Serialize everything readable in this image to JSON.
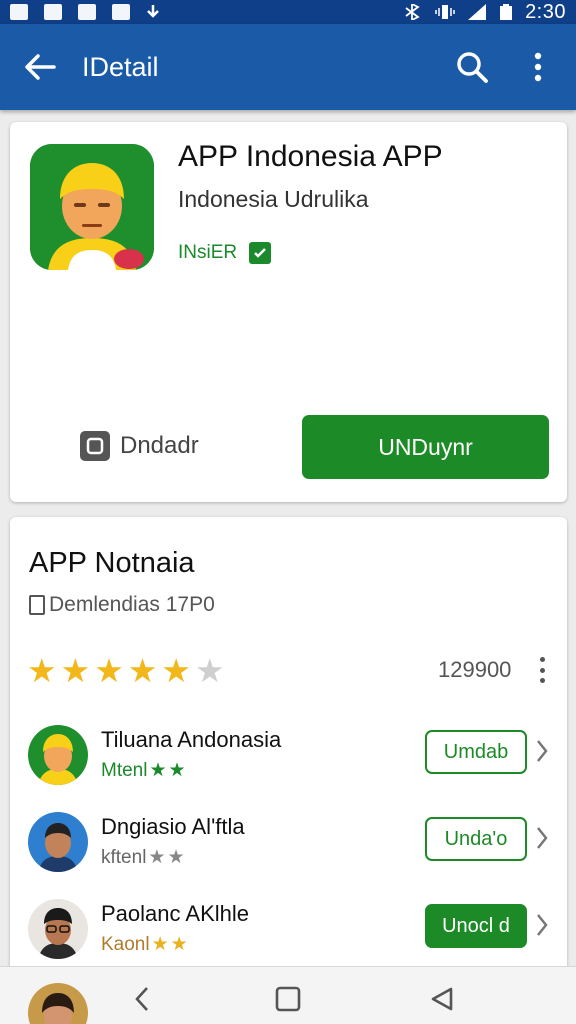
{
  "status_bar": {
    "time": "2:30"
  },
  "app_bar": {
    "title": "IDetail",
    "back_icon": "arrow-left-icon",
    "search_icon": "search-icon",
    "more_icon": "more-vert-icon"
  },
  "header_card": {
    "app_name": "APP Indonesia APP",
    "developer": "Indonesia Udrulika",
    "badge": "INsiER",
    "secondary_button": "Dndadr",
    "primary_button": "UNDuynr"
  },
  "info_card": {
    "title": "APP Notnaia",
    "subtitle": "Demlendias 17P0",
    "rating": 4,
    "rating_max": 5,
    "rating_count": "129900",
    "items": [
      {
        "title": "Tiluana Andonasia",
        "sub": "Mtenl",
        "stars": 2,
        "button": "Umdab",
        "style": "outline"
      },
      {
        "title": "Dngiasio Al'ftla",
        "sub": "kftenl",
        "stars": 2,
        "button": "Unda'o",
        "style": "outline"
      },
      {
        "title": "Paolanc AKlhle",
        "sub": "Kaonl",
        "stars": 2,
        "button": "Unocl d",
        "style": "filled"
      }
    ]
  },
  "colors": {
    "app_bar": "#1a5aa6",
    "status_bar": "#0f3f88",
    "accent_green": "#1c8a26",
    "star": "#f2b71b"
  }
}
